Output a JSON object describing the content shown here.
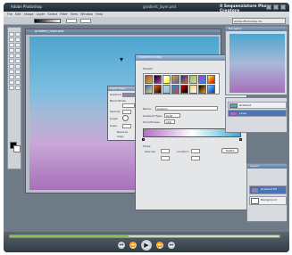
{
  "app": {
    "title": "Adobe Photoshop",
    "document_title": "gradient_layer.psd",
    "right_title": "Il Sequenziatore Photo Creatore"
  },
  "menus": [
    "File",
    "Edit",
    "Image",
    "Layer",
    "Select",
    "Filter",
    "View",
    "Window",
    "Help"
  ],
  "options_bar": {
    "brush_label": "Adobe Photoshop CS"
  },
  "gradient_editor": {
    "title": "Gradient Editor",
    "presets_label": "Presets",
    "buttons": [
      "OK",
      "Cancel",
      "Load...",
      "Save..."
    ],
    "name_label": "Name:",
    "name_value": "Custom",
    "new_button": "New",
    "type_label": "Gradient Type:",
    "type_value": "Solid",
    "smooth_label": "Smoothness:",
    "smooth_value": "100",
    "stops_label": "Stops",
    "opacity_label": "Opacity:",
    "location_label": "Location:",
    "delete_button": "Delete",
    "preset_colors": [
      "#e33",
      "#000",
      "#fff",
      "#f90",
      "#03c",
      "#9c3",
      "#c3c",
      "#ff0",
      "#36c",
      "#f60",
      "#ccc",
      "#09f",
      "#c00",
      "#fc6",
      "#000",
      "#6cf"
    ]
  },
  "layer_style": {
    "title": "Layer Style",
    "fields": [
      "Gradient",
      "Blend Mode",
      "Opacity",
      "Angle",
      "Scale",
      "Reverse",
      "Align"
    ]
  },
  "panels": {
    "navigator_title": "Navigator",
    "layers_title": "Layers",
    "layers": [
      {
        "name": "Gradient Fill",
        "selected": true
      },
      {
        "name": "Background",
        "selected": false
      }
    ],
    "history_rows": [
      {
        "name": "Gradient",
        "selected": false
      },
      {
        "name": "Layer",
        "selected": true
      }
    ]
  },
  "player": {
    "progress": 0.44,
    "buttons": [
      "⏮",
      "⏪",
      "▶",
      "⏩",
      "⏭"
    ],
    "accent": "#8dc157"
  }
}
